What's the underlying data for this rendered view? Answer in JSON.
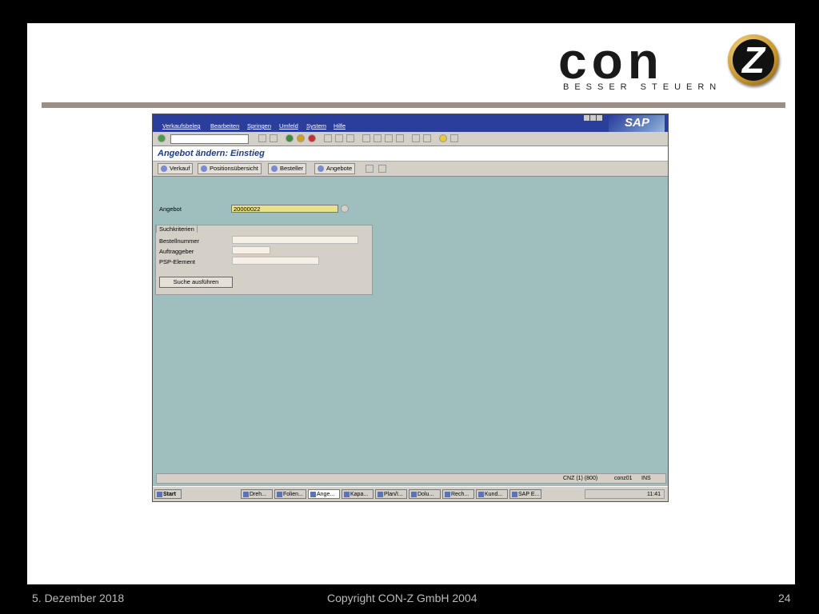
{
  "logo": {
    "word": "con",
    "emblem": "Z",
    "tagline": "BESSER STEUERN"
  },
  "sap": {
    "menu": [
      "Verkaufsbeleg",
      "Bearbeiten",
      "Springen",
      "Umfeld",
      "System",
      "Hilfe"
    ],
    "logo_text": "SAP",
    "screen_title": "Angebot ändern: Einstieg",
    "app_buttons": [
      "Verkauf",
      "Positionsübersicht",
      "Besteller",
      "Angebote"
    ],
    "fields": {
      "angebot_label": "Angebot",
      "angebot_value": "20000022",
      "group_title": "Suchkriterien",
      "bestellnummer_label": "Bestellnummer",
      "auftraggeber_label": "Auftraggeber",
      "psp_label": "PSP-Element",
      "search_button": "Suche ausführen"
    },
    "status": {
      "system": "CNZ (1) (800)",
      "user": "conz01",
      "mode": "INS"
    },
    "taskbar": {
      "start": "Start",
      "items": [
        "Dreh...",
        "Folien...",
        "Ange...",
        "Kapa...",
        "Plan/I...",
        "Dolu...",
        "Rech...",
        "Kund...",
        "SAP E..."
      ],
      "active_index": 2,
      "clock": "11:41"
    }
  },
  "footer": {
    "date": "5. Dezember 2018",
    "copyright": "Copyright CON-Z GmbH 2004",
    "page": "24"
  }
}
